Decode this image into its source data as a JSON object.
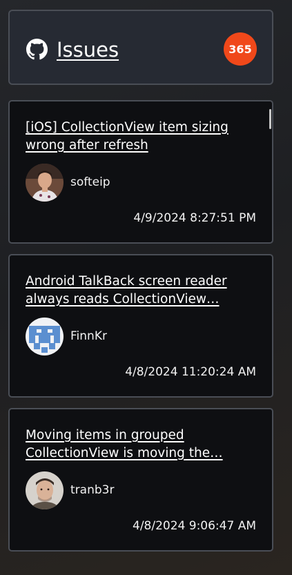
{
  "header": {
    "icon": "github-icon",
    "title": "Issues",
    "count": "365"
  },
  "colors": {
    "badge": "#f0481a",
    "card_background": "#0e0f12",
    "border": "#4a4e56"
  },
  "issues": [
    {
      "title": "[iOS] CollectionView item sizing wrong after refresh",
      "username": "softeip",
      "timestamp": "4/9/2024 8:27:51 PM",
      "avatar": "user-photo-avatar"
    },
    {
      "title": "Android TalkBack screen reader always reads CollectionView…",
      "username": "FinnKr",
      "timestamp": "4/8/2024 11:20:24 AM",
      "avatar": "identicon-avatar"
    },
    {
      "title": "Moving items in grouped CollectionView is moving the…",
      "username": "tranb3r",
      "timestamp": "4/8/2024 9:06:47 AM",
      "avatar": "user-photo-avatar"
    }
  ]
}
